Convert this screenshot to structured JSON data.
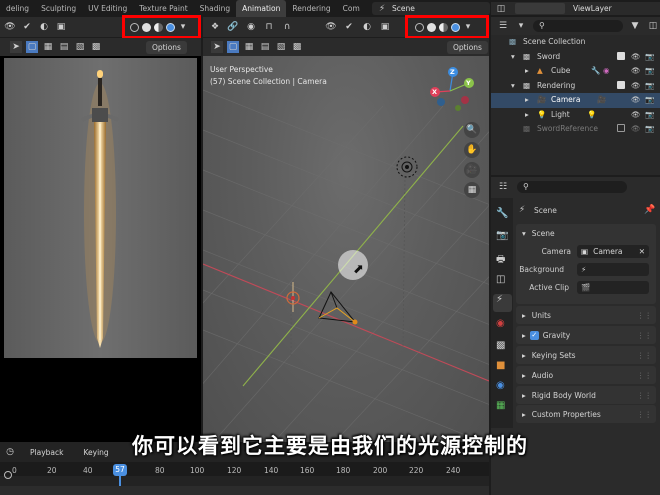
{
  "workspace_tabs": [
    "deling",
    "Sculpting",
    "UV Editing",
    "Texture Paint",
    "Shading",
    "Animation",
    "Rendering",
    "Com"
  ],
  "active_tab": "Animation",
  "scene": {
    "icon": "scene-icon",
    "name": "Scene"
  },
  "view_layer": {
    "icon": "view-layer-icon",
    "name": "ViewLayer"
  },
  "left_view": {
    "options_label": "Options"
  },
  "main_view": {
    "options_label": "Options",
    "perspective_label": "User Perspective",
    "collection_label": "(57) Scene Collection | Camera",
    "gizmo": {
      "x": "X",
      "y": "Y",
      "z": "Z"
    }
  },
  "outliner": {
    "items": [
      {
        "label": "Scene Collection"
      },
      {
        "label": "Sword"
      },
      {
        "label": "Cube"
      },
      {
        "label": "Rendering"
      },
      {
        "label": "Camera"
      },
      {
        "label": "Light"
      },
      {
        "label": "SwordReference"
      }
    ]
  },
  "properties": {
    "context_label": "Scene",
    "scene_panel": {
      "header": "Scene",
      "camera_label": "Camera",
      "camera_value": "Camera",
      "background_label": "Background",
      "active_clip_label": "Active Clip"
    },
    "panels": [
      "Units",
      "Gravity",
      "Keying Sets",
      "Audio",
      "Rigid Body World",
      "Custom Properties"
    ],
    "gravity_checked": true
  },
  "timeline": {
    "playback_label": "Playback",
    "keying_label": "Keying",
    "current_frame": "57",
    "ticks": [
      "0",
      "20",
      "40",
      "57",
      "80",
      "100",
      "120",
      "140",
      "160",
      "180",
      "200",
      "220",
      "240"
    ]
  },
  "subtitle": "你可以看到它主要是由我们的光源控制的",
  "colors": {
    "highlight_box": "#ff0000",
    "x_axis": "#e0405a",
    "y_axis": "#8bc34a",
    "z_axis": "#3c8de0",
    "active_tab_bg": "#3d3d3d",
    "playhead": "#4a8fe0"
  }
}
